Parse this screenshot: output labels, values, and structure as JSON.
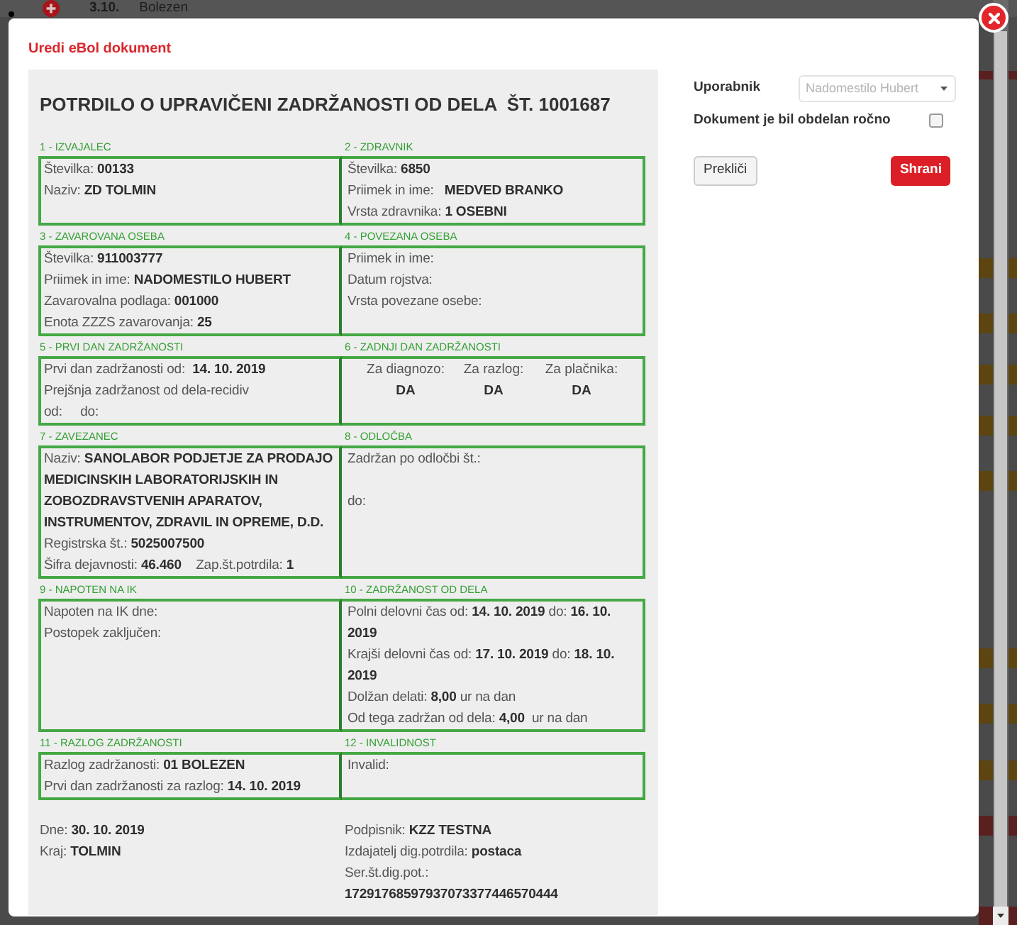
{
  "background_row": {
    "number": "3.10.",
    "label": "Bolezen"
  },
  "dialog": {
    "title": "Uredi eBol dokument"
  },
  "document": {
    "title": "POTRDILO O UPRAVIČENI ZADRŽANOSTI OD DELA  ŠT. 1001687",
    "sections": [
      {
        "cells": [
          {
            "label": "1 - IZVAJALEC",
            "kind": "lines",
            "lines": [
              {
                "text": "Številka: **00133**"
              },
              {
                "text": "Naziv: **ZD TOLMIN**"
              }
            ]
          },
          {
            "label": "2 - ZDRAVNIK",
            "kind": "lines",
            "lines": [
              {
                "text": "Številka: **6850**"
              },
              {
                "text": "Priimek in ime:   **MEDVED BRANKO**"
              },
              {
                "text": "Vrsta zdravnika: **1 OSEBNI**"
              }
            ]
          }
        ]
      },
      {
        "cells": [
          {
            "label": "3 - ZAVAROVANA OSEBA",
            "kind": "lines",
            "lines": [
              {
                "text": "Številka: **911003777**"
              },
              {
                "text": "Priimek in ime: **NADOMESTILO HUBERT**"
              },
              {
                "text": "Zavarovalna podlaga: **001000**"
              },
              {
                "text": "Enota ZZZS zavarovanja: **25**"
              }
            ]
          },
          {
            "label": "4 - POVEZANA OSEBA",
            "kind": "lines",
            "lines": [
              {
                "text": "Priimek in ime:"
              },
              {
                "text": "Datum rojstva:"
              },
              {
                "text": "Vrsta povezane osebe:"
              }
            ]
          }
        ]
      },
      {
        "cells": [
          {
            "label": "5 - PRVI DAN ZADRŽANOSTI",
            "kind": "lines",
            "lines": [
              {
                "text": "Prvi dan zadržanosti od:  **14. 10. 2019**"
              },
              {
                "text": "Prejšnja zadržanost od dela-recidiv"
              },
              {
                "text": "od:     do:"
              }
            ]
          },
          {
            "label": "6 - ZADNJI DAN ZADRŽANOSTI",
            "kind": "columns",
            "columns": [
              {
                "heading": "Za diagnozo:",
                "value": "DA"
              },
              {
                "heading": "Za razlog:",
                "value": "DA"
              },
              {
                "heading": "Za plačnika:",
                "value": "DA"
              }
            ]
          }
        ]
      },
      {
        "cells": [
          {
            "label": "7 - ZAVEZANEC",
            "kind": "lines",
            "lines": [
              {
                "text": "Naziv: **SANOLABOR PODJETJE ZA PRODAJO MEDICINSKIH LABORATORIJSKIH IN ZOBOZDRAVSTVENIH APARATOV, INSTRUMENTOV, ZDRAVIL IN OPREME, D.D.**"
              },
              {
                "text": "Registrska št.: **5025007500**"
              },
              {
                "text": "Šifra dejavnosti: **46.460**    Zap.št.potrdila: **1**"
              }
            ]
          },
          {
            "label": "8 - ODLOČBA",
            "kind": "spaced_lines",
            "lines": [
              {
                "text": "Zadržan po odločbi št.:"
              },
              {
                "text": "do:"
              }
            ]
          }
        ]
      },
      {
        "cells": [
          {
            "label": "9 - NAPOTEN NA IK",
            "kind": "lines",
            "lines": [
              {
                "text": "Napoten na IK dne:"
              },
              {
                "text": "Postopek zaključen:"
              }
            ]
          },
          {
            "label": "10 - ZADRŽANOST OD DELA",
            "kind": "lines",
            "lines": [
              {
                "text": "Polni delovni čas od: **14. 10. 2019** do: **16. 10. 2019**"
              },
              {
                "text": "Krajši delovni čas od: **17. 10. 2019** do: **18. 10. 2019**"
              },
              {
                "text": "Dolžan delati: **8,00** ur na dan"
              },
              {
                "text": "Od tega zadržan od dela: **4,00**  ur na dan"
              }
            ]
          }
        ]
      },
      {
        "cells": [
          {
            "label": "11 - RAZLOG ZADRŽANOSTI",
            "kind": "lines",
            "lines": [
              {
                "text": "Razlog zadržanosti: **01 BOLEZEN**"
              },
              {
                "text": "Prvi dan zadržanosti za razlog: **14. 10. 2019**"
              }
            ]
          },
          {
            "label": "12 - INVALIDNOST",
            "kind": "lines",
            "lines": [
              {
                "text": "Invalid:"
              }
            ]
          }
        ]
      }
    ],
    "footer": {
      "left": [
        "Dne: **30. 10. 2019**",
        "Kraj: **TOLMIN**"
      ],
      "right": [
        "Podpisnik: **KZZ TESTNA**",
        "Izdajatelj dig.potrdila: **postaca**",
        "Ser.št.dig.pot.: **17291768597937073377446570444**"
      ]
    }
  },
  "form": {
    "user": {
      "label": "Uporabnik",
      "value": "Nadomestilo Hubert",
      "disabled": true
    },
    "manual": {
      "label": "Dokument je bil obdelan ročno",
      "checked": false
    },
    "buttons": [
      {
        "label": "Prekliči",
        "kind": "secondary"
      },
      {
        "label": "Shrani",
        "kind": "primary"
      }
    ]
  }
}
